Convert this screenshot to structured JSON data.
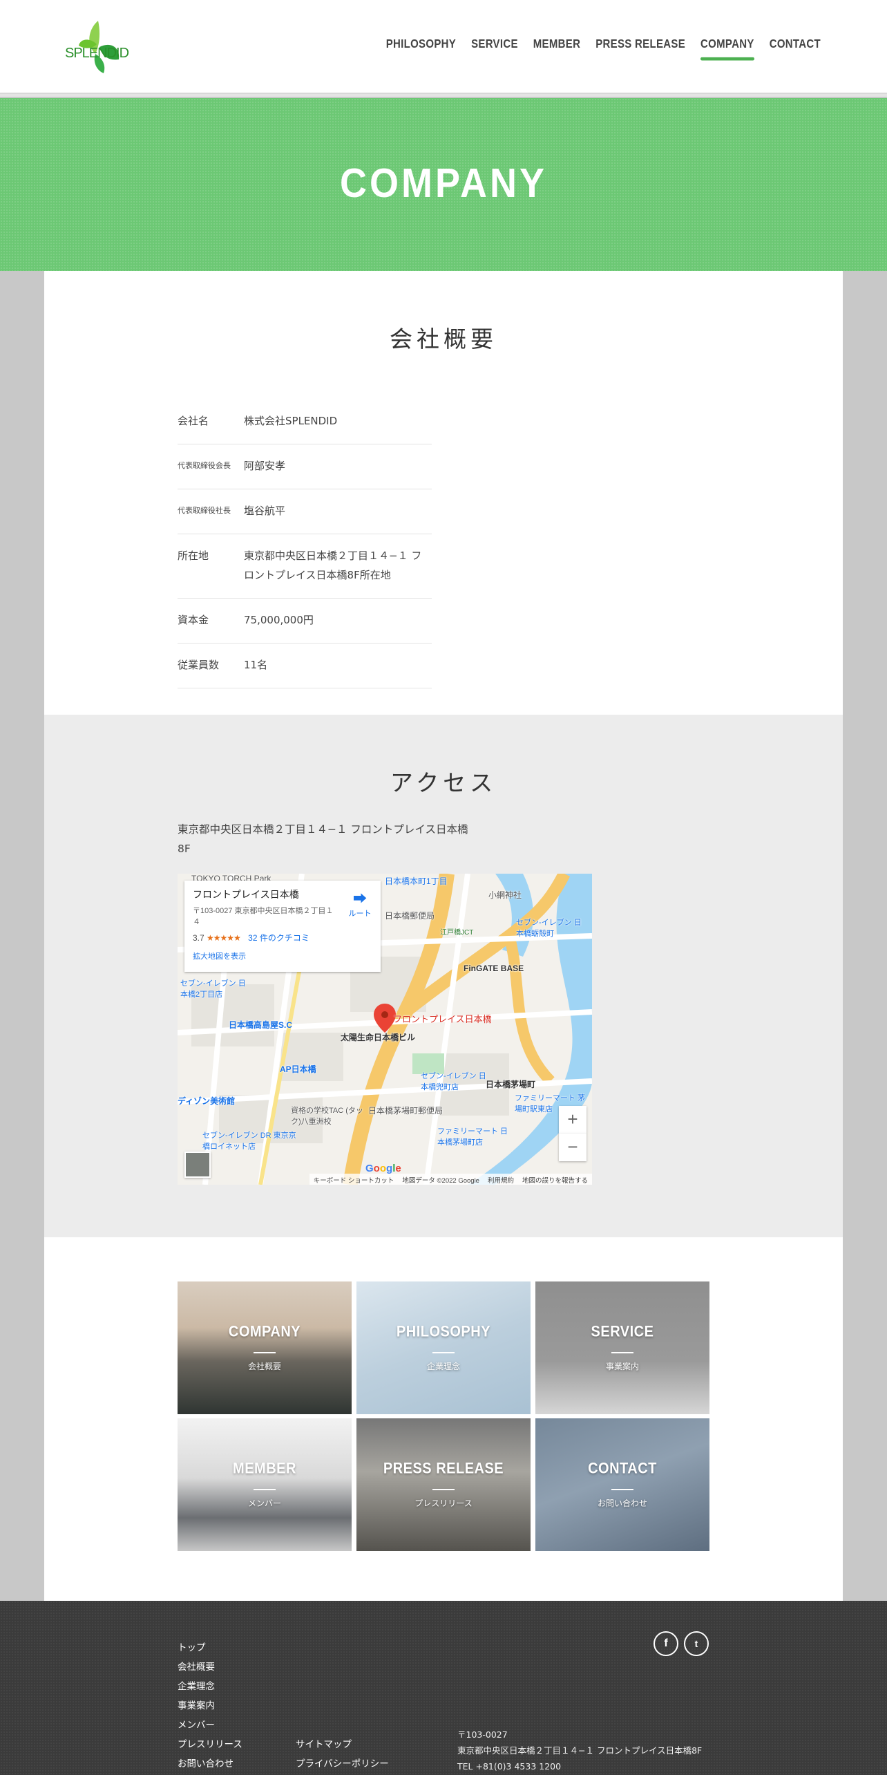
{
  "header": {
    "logo_text": "SPLENDID",
    "nav": [
      "PHILOSOPHY",
      "SERVICE",
      "MEMBER",
      "PRESS RELEASE",
      "COMPANY",
      "CONTACT"
    ],
    "active_nav": "COMPANY"
  },
  "hero": {
    "title": "COMPANY"
  },
  "overview": {
    "title": "会社概要",
    "rows": [
      {
        "label": "会社名",
        "value": "株式会社SPLENDID"
      },
      {
        "label": "代表取締役会長",
        "value": "阿部安孝"
      },
      {
        "label": "代表取締役社長",
        "value": "塩谷航平"
      },
      {
        "label": "所在地",
        "value": "東京都中央区日本橋２丁目１４−１ フロントプレイス日本橋8F所在地"
      },
      {
        "label": "資本金",
        "value": "75,000,000円"
      },
      {
        "label": "従業員数",
        "value": "11名"
      }
    ]
  },
  "access": {
    "title": "アクセス",
    "address_line1": "東京都中央区日本橋２丁目１４−１ フロントプレイス日本橋",
    "address_line2": "8F",
    "map": {
      "place_name": "フロントプレイス日本橋",
      "place_address": "〒103-0027 東京都中央区日本橋２丁目１４",
      "rating": "3.7",
      "stars": "★★★★★",
      "reviews": "32 件のクチコミ",
      "larger_map": "拡大地図を表示",
      "route": "ルート",
      "pin_label": "フロントプレイス日本橋",
      "zoom_in": "+",
      "zoom_out": "−",
      "google": "Google",
      "footer": [
        "キーボード ショートカット",
        "地図データ ©2022 Google",
        "利用規約",
        "地図の誤りを報告する"
      ],
      "labels": [
        {
          "text": "TOKYO TORCH Park",
          "cls": ""
        },
        {
          "text": "日本橋本町1丁目",
          "cls": "blue"
        },
        {
          "text": "小網神社",
          "cls": ""
        },
        {
          "text": "日本橋郵便局",
          "cls": ""
        },
        {
          "text": "江戸橋JCT",
          "cls": ""
        },
        {
          "text": "セブン-イレブン 日本橋蛎殻町",
          "cls": "blue"
        },
        {
          "text": "FinGATE BASE",
          "cls": "bold"
        },
        {
          "text": "セブン-イレブン 日本橋2丁目店",
          "cls": "blue"
        },
        {
          "text": "日本橋高島屋S.C",
          "cls": "blue"
        },
        {
          "text": "太陽生命日本橋ビル",
          "cls": "bold"
        },
        {
          "text": "AP日本橋",
          "cls": "blue"
        },
        {
          "text": "日本橋茅場町",
          "cls": "bold"
        },
        {
          "text": "セブン-イレブン 日本橋兜町店",
          "cls": "blue"
        },
        {
          "text": "資格の学校TAC (タック)八重洲校",
          "cls": ""
        },
        {
          "text": "日本橋茅場町郵便局",
          "cls": ""
        },
        {
          "text": "ファミリーマート 茅場町駅東店",
          "cls": "blue"
        },
        {
          "text": "ファミリーマート 日本橋茅場町店",
          "cls": "blue"
        },
        {
          "text": "セブン-イレブン DR 東京京橋ロイネット店",
          "cls": "blue"
        },
        {
          "text": "ディゾン美術館",
          "cls": "blue"
        }
      ]
    }
  },
  "tiles": [
    {
      "title": "COMPANY",
      "sub": "会社概要"
    },
    {
      "title": "PHILOSOPHY",
      "sub": "企業理念"
    },
    {
      "title": "SERVICE",
      "sub": "事業案内"
    },
    {
      "title": "MEMBER",
      "sub": "メンバー"
    },
    {
      "title": "PRESS RELEASE",
      "sub": "プレスリリース"
    },
    {
      "title": "CONTACT",
      "sub": "お問い合わせ"
    }
  ],
  "footer": {
    "links_col1": [
      "トップ",
      "会社概要",
      "企業理念",
      "事業案内",
      "メンバー",
      "プレスリリース",
      "お問い合わせ"
    ],
    "links_col2": [
      "サイトマップ",
      "プライバシーポリシー"
    ],
    "postal": "〒103-0027",
    "address": "東京都中央区日本橋２丁目１４−１ フロントプレイス日本橋8F",
    "tel": "TEL +81(0)3 4533 1200",
    "social": [
      "f",
      "t"
    ]
  },
  "colors": {
    "accent": "#4cb050",
    "hero": "#6cc874",
    "footer": "#3b3b3b"
  }
}
